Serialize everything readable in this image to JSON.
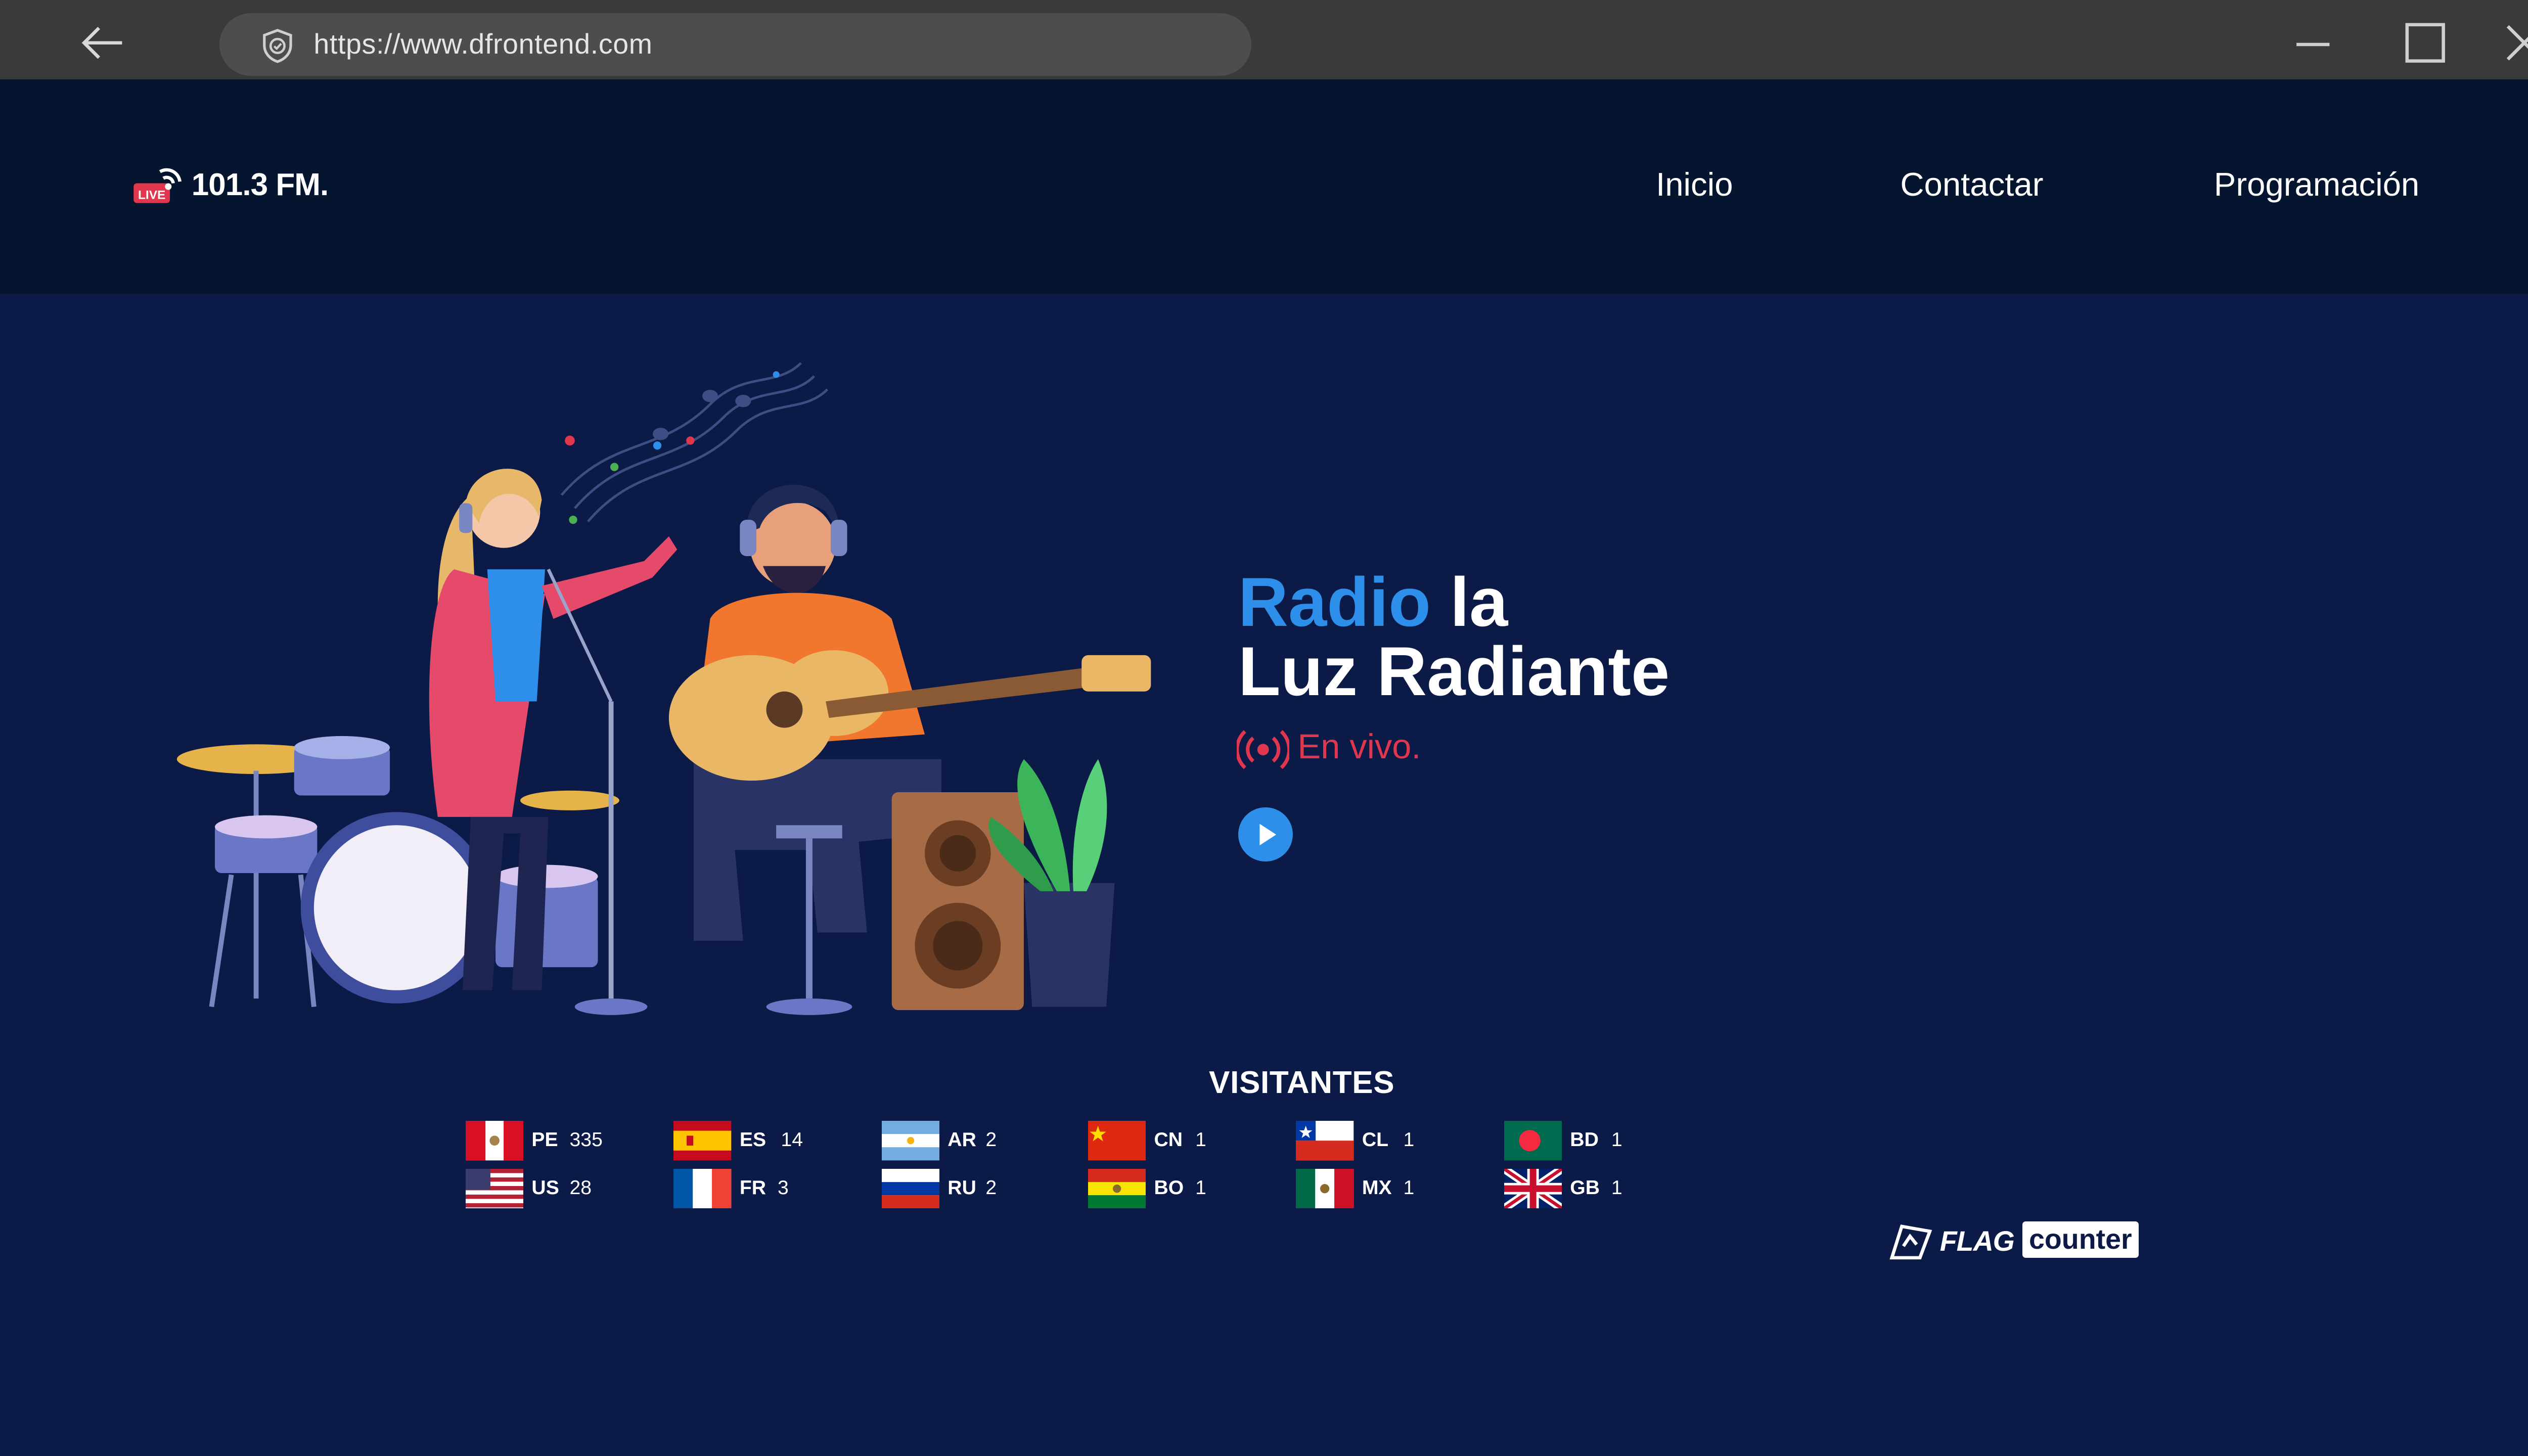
{
  "browser": {
    "url": "https://www.dfrontend.com",
    "icons": [
      "back-arrow-icon",
      "shield-icon",
      "minimize-icon",
      "maximize-icon",
      "close-icon"
    ]
  },
  "site": {
    "logo_badge": "LIVE",
    "logo_text": "101.3 FM.",
    "nav": [
      {
        "label": "Inicio"
      },
      {
        "label": "Contactar"
      },
      {
        "label": "Programación"
      }
    ]
  },
  "hero": {
    "title_word1": "Radio",
    "title_word2": " la",
    "title_line2": "Luz Radiante",
    "live_label": "En vivo.",
    "colors": {
      "accent": "#2d8fea",
      "live": "#e0374f",
      "background": "#0b1a46",
      "nav": "#06152f"
    }
  },
  "visitors": {
    "title": "VISITANTES",
    "entries": [
      {
        "code": "PE",
        "count": "335"
      },
      {
        "code": "US",
        "count": "28"
      },
      {
        "code": "ES",
        "count": "14"
      },
      {
        "code": "FR",
        "count": "3"
      },
      {
        "code": "AR",
        "count": "2"
      },
      {
        "code": "RU",
        "count": "2"
      },
      {
        "code": "CN",
        "count": "1"
      },
      {
        "code": "BO",
        "count": "1"
      },
      {
        "code": "CL",
        "count": "1"
      },
      {
        "code": "MX",
        "count": "1"
      },
      {
        "code": "BD",
        "count": "1"
      },
      {
        "code": "GB",
        "count": "1"
      }
    ],
    "badge_flag": "FLAG",
    "badge_counter": "counter"
  }
}
